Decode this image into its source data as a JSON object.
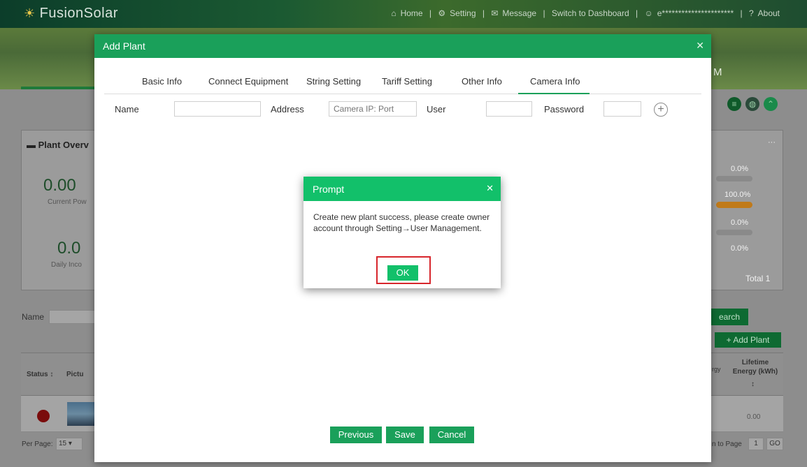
{
  "app": {
    "name": "FusionSolar",
    "nav": [
      "Home",
      "|",
      "Setting",
      "|",
      "Message",
      "|",
      "Switch to Dashboard",
      "|",
      "e**********************",
      "|",
      "About"
    ],
    "banner_fragment": "M"
  },
  "background": {
    "panel_title": "Plant Overv",
    "current_power_value": "0.00",
    "current_power_label": "Current Pow",
    "daily_income_value": "0.0",
    "daily_income_label": "Daily Inco",
    "right_percents": [
      "0.0%",
      "100.0%",
      "0.0%",
      "0.0%"
    ],
    "total_label": "Total 1",
    "more": "···",
    "filter_name_label": "Name",
    "search_button": "earch",
    "add_plant_button": "+ Add Plant",
    "table": {
      "col_status": "Status ↕",
      "col_picture": "Pictu",
      "col_energy_fragment": "rgy",
      "col_lifetime": "Lifetime Energy (kWh)",
      "sort_symbol": "↕",
      "row_value": "0.00"
    },
    "pagination": {
      "per_page_label": "Per Page:",
      "per_page_value": "15",
      "to_page_label": "n to Page",
      "page_value": "1",
      "go_label": "GO"
    }
  },
  "modal": {
    "title": "Add Plant",
    "tabs": [
      "Basic Info",
      "Connect Equipment",
      "String Setting",
      "Tariff Setting",
      "Other Info",
      "Camera Info"
    ],
    "active_tab": "Camera Info",
    "fields": {
      "name_label": "Name",
      "name_value": "",
      "address_label": "Address",
      "address_placeholder": "Camera IP: Port",
      "user_label": "User",
      "user_value": "",
      "password_label": "Password",
      "password_value": ""
    },
    "buttons": {
      "previous": "Previous",
      "save": "Save",
      "cancel": "Cancel"
    }
  },
  "prompt": {
    "title": "Prompt",
    "message": "Create new plant success, please create owner account through Setting→User Management.",
    "ok": "OK"
  },
  "colors": {
    "modal_header": "#1aa05a",
    "prompt_header": "#12c06a",
    "highlight": "#d7262c"
  }
}
